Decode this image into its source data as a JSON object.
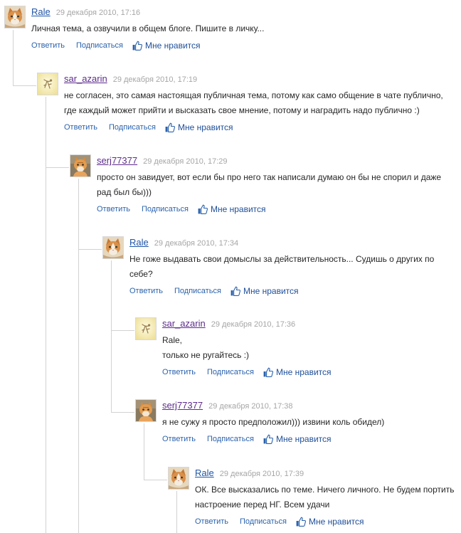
{
  "colors": {
    "link": "#1f55a6",
    "visited_link": "#5d2c8c",
    "date": "#a6a6a6",
    "text": "#262626",
    "action": "#2c63ad",
    "like": "#1f4f99",
    "thread_line": "#d2d2d2"
  },
  "icons": {
    "like": "thumbs-up-icon"
  },
  "actions": {
    "reply": "Ответить",
    "subscribe": "Подписаться",
    "like": "Мне нравится"
  },
  "thread": {
    "author": "Rale",
    "date": "29 декабря 2010, 17:16",
    "lines": [
      "Личная тема, а озвучили в общем блоге. Пишите в личку..."
    ],
    "replies": [
      {
        "author": "sar_azarin",
        "date": "29 декабря 2010, 17:19",
        "lines": [
          "не согласен, это самая настоящая публичная тема, потому как само общение в чате публично,",
          "где каждый может прийти и высказать свое мнение, потому и наградить надо публично :)"
        ],
        "replies": [
          {
            "author": "serj77377",
            "date": "29 декабря 2010, 17:29",
            "lines": [
              "просто он завидует, вот если бы про него так написали думаю он бы не спорил и даже",
              "рад был бы)))"
            ],
            "replies": [
              {
                "author": "Rale",
                "date": "29 декабря 2010, 17:34",
                "lines": [
                  "Не гоже выдавать свои домыслы за действительность... Судишь о других по",
                  "себе?"
                ],
                "replies": [
                  {
                    "author": "sar_azarin",
                    "date": "29 декабря 2010, 17:36",
                    "lines": [
                      "Rale,",
                      "только не ругайтесь :)"
                    ]
                  },
                  {
                    "author": "serj77377",
                    "date": "29 декабря 2010, 17:38",
                    "lines": [
                      "я не сужу я просто предположил))) извини коль обидел)"
                    ],
                    "replies": [
                      {
                        "author": "Rale",
                        "date": "29 декабря 2010, 17:39",
                        "lines": [
                          "ОК. Все высказались по теме. Ничего личного. Не будем портить",
                          "настроение перед НГ. Всем удачи"
                        ]
                      }
                    ]
                  }
                ]
              }
            ]
          }
        ]
      }
    ]
  }
}
